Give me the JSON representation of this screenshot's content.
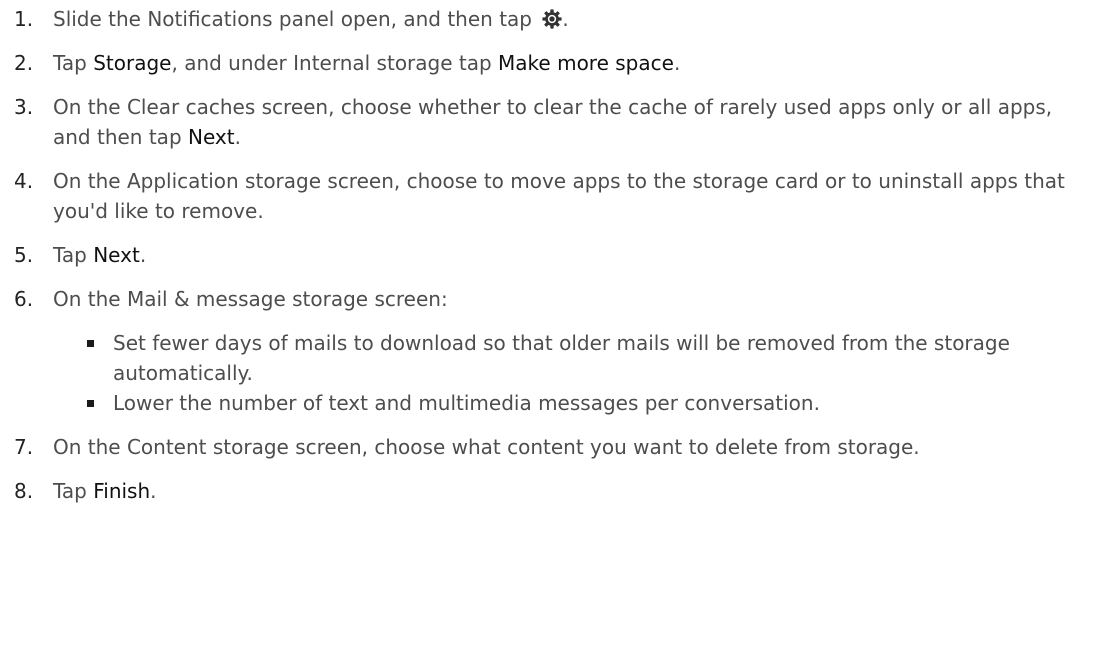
{
  "steps": [
    {
      "num": "1.",
      "parts": [
        {
          "t": "Slide the Notifications panel open, and then tap "
        },
        {
          "icon": "gear-icon"
        },
        {
          "t": "."
        }
      ]
    },
    {
      "num": "2.",
      "parts": [
        {
          "t": "Tap "
        },
        {
          "t": "Storage",
          "kw": true
        },
        {
          "t": ", and under Internal storage tap "
        },
        {
          "t": "Make more space",
          "kw": true
        },
        {
          "t": "."
        }
      ]
    },
    {
      "num": "3.",
      "parts": [
        {
          "t": "On the Clear caches screen, choose whether to clear the cache of rarely used apps only or all apps, and then tap "
        },
        {
          "t": "Next",
          "kw": true
        },
        {
          "t": "."
        }
      ]
    },
    {
      "num": "4.",
      "parts": [
        {
          "t": "On the Application storage screen, choose to move apps to the storage card or to uninstall apps that you'd like to remove."
        }
      ]
    },
    {
      "num": "5.",
      "parts": [
        {
          "t": "Tap "
        },
        {
          "t": "Next",
          "kw": true
        },
        {
          "t": "."
        }
      ]
    },
    {
      "num": "6.",
      "parts": [
        {
          "t": "On the Mail & message storage screen:"
        }
      ],
      "subs": [
        "Set fewer days of mails to download so that older mails will be removed from the storage automatically.",
        "Lower the number of text and multimedia messages per conversation."
      ]
    },
    {
      "num": "7.",
      "parts": [
        {
          "t": "On the Content storage screen, choose what content you want to delete from storage."
        }
      ]
    },
    {
      "num": "8.",
      "parts": [
        {
          "t": "Tap "
        },
        {
          "t": "Finish",
          "kw": true
        },
        {
          "t": "."
        }
      ]
    }
  ],
  "colors": {
    "text": "#4d4d4d",
    "keyword": "#111111",
    "icon": "#333333"
  }
}
